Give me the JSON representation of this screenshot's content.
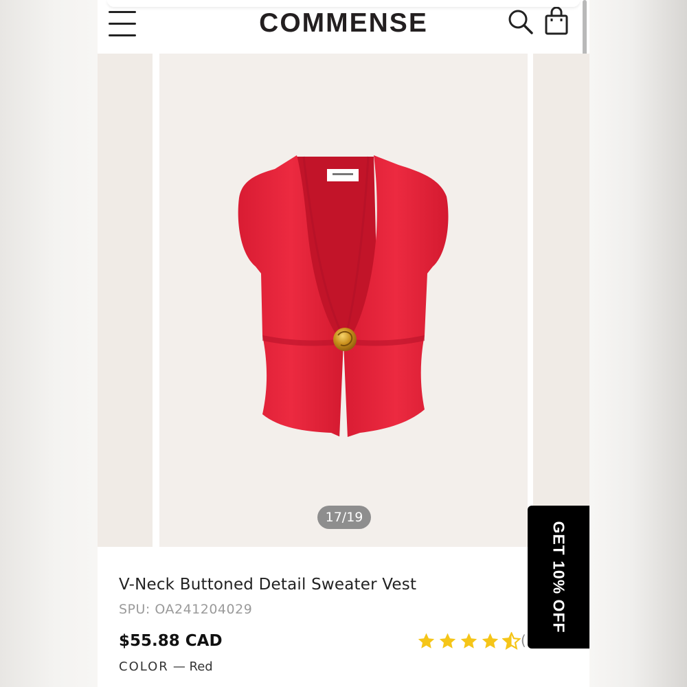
{
  "header": {
    "logo": "COMMENSE",
    "menu_icon": "hamburger-menu-icon",
    "search_icon": "search-icon",
    "bag_icon": "shopping-bag-icon"
  },
  "gallery": {
    "counter": "17/19",
    "current_index": 17,
    "total_images": 19,
    "product_color_hex": "#e8253b"
  },
  "product": {
    "title": "V-Neck Buttoned Detail Sweater Vest",
    "spu": "SPU: OA241204029",
    "price": "$55.88 CAD",
    "rating_stars": 4.5,
    "rating_open_paren": "(",
    "color_label": "COLOR",
    "color_value": "— Red"
  },
  "promo": {
    "label": "GET 10% OFF"
  },
  "colors": {
    "star": "#f5c518",
    "promo_bg": "#000000",
    "slide_bg": "#f3efeb"
  }
}
